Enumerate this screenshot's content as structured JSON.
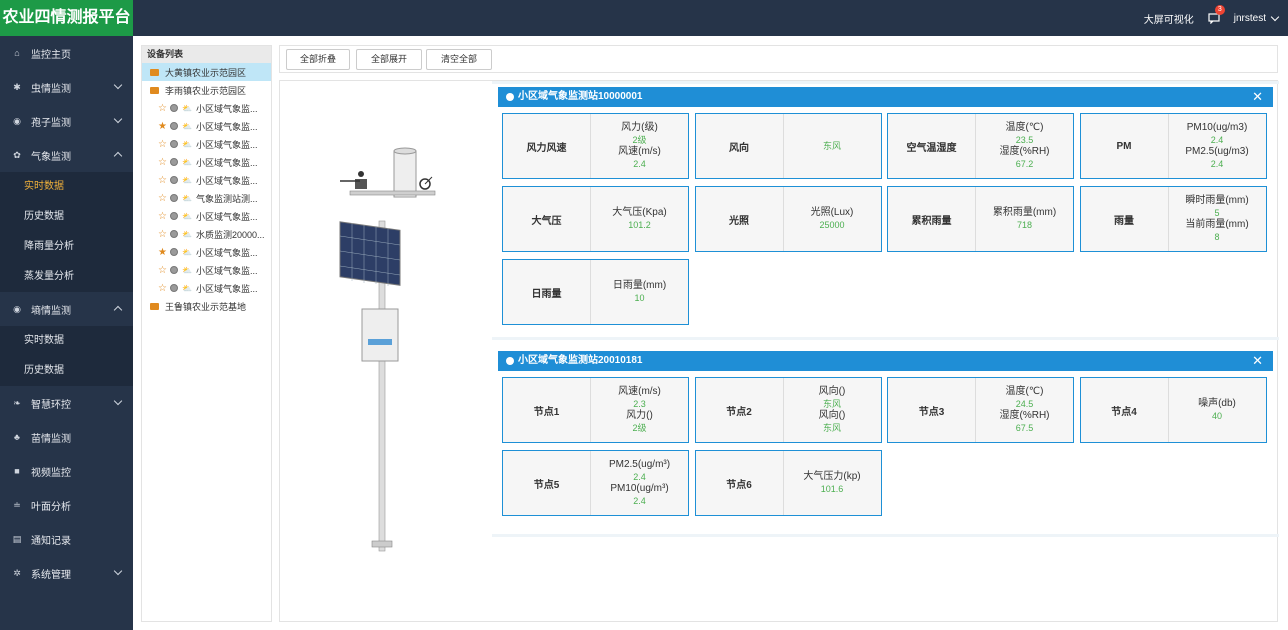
{
  "app": {
    "title": "农业四情测报平台"
  },
  "topbar": {
    "bigscreen": "大屏可视化",
    "msg_count": "3",
    "user": "jnrstest"
  },
  "sidebar": {
    "items": [
      {
        "label": "监控主页",
        "icon": "home-icon"
      },
      {
        "label": "虫情监测",
        "icon": "bug-icon",
        "chevron": "down"
      },
      {
        "label": "孢子监测",
        "icon": "globe-icon",
        "chevron": "down"
      },
      {
        "label": "气象监测",
        "icon": "gear-icon",
        "chevron": "up"
      },
      {
        "label": "墒情监测",
        "icon": "globe-icon",
        "chevron": "up"
      },
      {
        "label": "智慧环控",
        "icon": "leaf-icon",
        "chevron": "down"
      },
      {
        "label": "苗情监测",
        "icon": "tree-icon"
      },
      {
        "label": "视频监控",
        "icon": "video-icon"
      },
      {
        "label": "叶面分析",
        "icon": "leaf-analysis-icon"
      },
      {
        "label": "通知记录",
        "icon": "card-icon"
      },
      {
        "label": "系统管理",
        "icon": "settings-icon",
        "chevron": "down"
      }
    ],
    "weather_sub": [
      "实时数据",
      "历史数据",
      "降雨量分析",
      "蒸发量分析"
    ],
    "soil_sub": [
      "实时数据",
      "历史数据"
    ]
  },
  "tree": {
    "title": "设备列表",
    "rows": [
      {
        "label": "大黄镇农业示范园区",
        "type": "folder",
        "selected": true
      },
      {
        "label": "李雨镇农业示范园区",
        "type": "folder-open"
      },
      {
        "label": "小区域气象监...",
        "type": "device",
        "star": "empty"
      },
      {
        "label": "小区域气象监...",
        "type": "device",
        "star": "filled"
      },
      {
        "label": "小区域气象监...",
        "type": "device",
        "star": "empty"
      },
      {
        "label": "小区域气象监...",
        "type": "device",
        "star": "empty"
      },
      {
        "label": "小区域气象监...",
        "type": "device",
        "star": "empty"
      },
      {
        "label": "气象监测站测...",
        "type": "device",
        "star": "empty"
      },
      {
        "label": "小区域气象监...",
        "type": "device",
        "star": "empty"
      },
      {
        "label": "水质监测20000...",
        "type": "device",
        "star": "empty"
      },
      {
        "label": "小区域气象监...",
        "type": "device",
        "star": "filled"
      },
      {
        "label": "小区域气象监...",
        "type": "device",
        "star": "empty"
      },
      {
        "label": "小区域气象监...",
        "type": "device",
        "star": "empty"
      },
      {
        "label": "王鲁镇农业示范基地",
        "type": "folder"
      }
    ]
  },
  "toolbar": {
    "collapse": "全部折叠",
    "expand": "全部展开",
    "clear": "清空全部"
  },
  "panels": [
    {
      "title": "小区域气象监测站10000001",
      "close": "✕",
      "cards": [
        {
          "label": "风力风速",
          "vals": [
            [
              "风力(级)",
              "2级"
            ],
            [
              "风速(m/s)",
              "2.4"
            ]
          ]
        },
        {
          "label": "风向",
          "vals": [
            [
              "",
              "东风"
            ]
          ]
        },
        {
          "label": "空气温湿度",
          "vals": [
            [
              "温度(℃)",
              "23.5"
            ],
            [
              "湿度(%RH)",
              "67.2"
            ]
          ]
        },
        {
          "label": "PM",
          "vals": [
            [
              "PM10(ug/m3)",
              "2.4"
            ],
            [
              "PM2.5(ug/m3)",
              "2.4"
            ]
          ]
        },
        {
          "label": "大气压",
          "vals": [
            [
              "大气压(Kpa)",
              "101.2"
            ]
          ]
        },
        {
          "label": "光照",
          "vals": [
            [
              "光照(Lux)",
              "25000"
            ]
          ]
        },
        {
          "label": "累积雨量",
          "vals": [
            [
              "累积雨量(mm)",
              "718"
            ]
          ]
        },
        {
          "label": "雨量",
          "vals": [
            [
              "瞬时雨量(mm)",
              "5"
            ],
            [
              "当前雨量(mm)",
              "8"
            ]
          ]
        },
        {
          "label": "日雨量",
          "vals": [
            [
              "日雨量(mm)",
              "10"
            ]
          ]
        }
      ]
    },
    {
      "title": "小区域气象监测站20010181",
      "close": "✕",
      "cards": [
        {
          "label": "节点1",
          "vals": [
            [
              "风速(m/s)",
              "2.3"
            ],
            [
              "风力()",
              "2级"
            ]
          ]
        },
        {
          "label": "节点2",
          "vals": [
            [
              "风向()",
              "东风"
            ],
            [
              "风向()",
              "东风"
            ]
          ]
        },
        {
          "label": "节点3",
          "vals": [
            [
              "温度(℃)",
              "24.5"
            ],
            [
              "湿度(%RH)",
              "67.5"
            ]
          ]
        },
        {
          "label": "节点4",
          "vals": [
            [
              "噪声(db)",
              "40"
            ]
          ]
        },
        {
          "label": "节点5",
          "vals": [
            [
              "PM2.5(ug/m³)",
              "2.4"
            ],
            [
              "PM10(ug/m³)",
              "2.4"
            ]
          ]
        },
        {
          "label": "节点6",
          "vals": [
            [
              "大气压力(kp)",
              "101.6"
            ]
          ]
        }
      ]
    }
  ]
}
